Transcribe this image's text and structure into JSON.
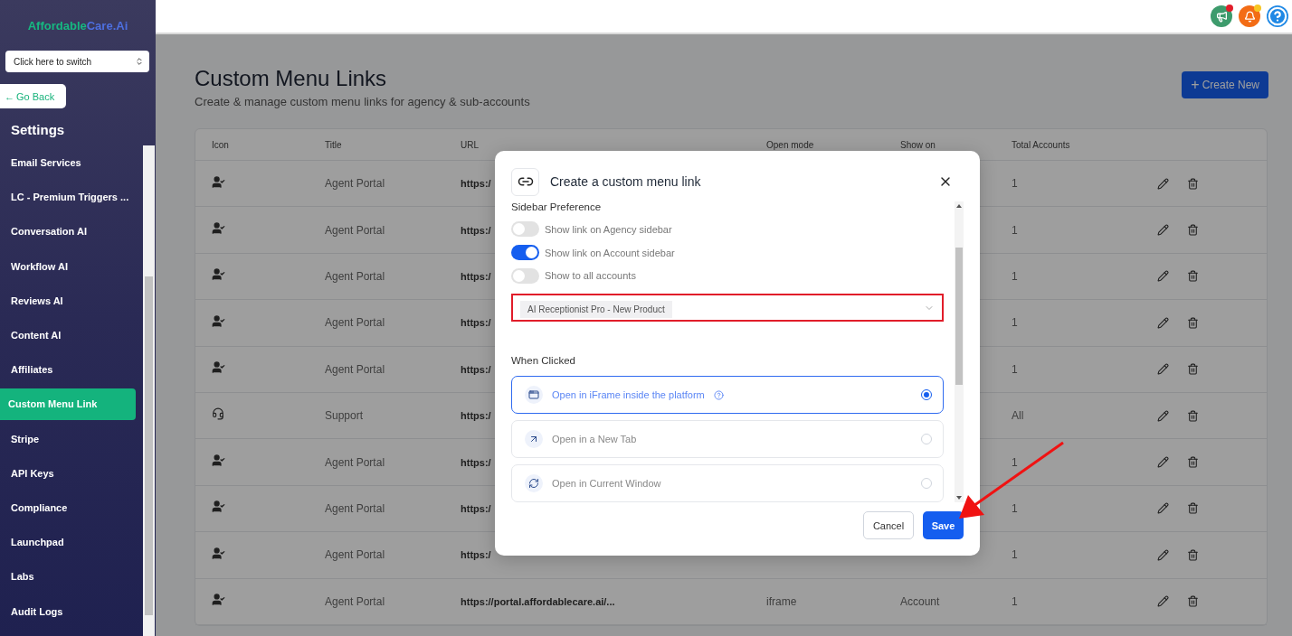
{
  "sidebar": {
    "logo": {
      "part_1": "Affordable",
      "part_2": "Care.Ai"
    },
    "switcher": {
      "value": "Click here to switch"
    },
    "back_button": {
      "icon": "←",
      "label": "Go Back"
    },
    "heading": "Settings",
    "items": [
      {
        "label": "Email Services",
        "selected": false
      },
      {
        "label": "LC - Premium Triggers ...",
        "selected": false
      },
      {
        "label": "Conversation AI",
        "selected": false
      },
      {
        "label": "Workflow AI",
        "selected": false
      },
      {
        "label": "Reviews AI",
        "selected": false
      },
      {
        "label": "Content AI",
        "selected": false
      },
      {
        "label": "Affiliates",
        "selected": false
      },
      {
        "label": "Custom Menu Link",
        "selected": true
      },
      {
        "label": "Stripe",
        "selected": false
      },
      {
        "label": "API Keys",
        "selected": false
      },
      {
        "label": "Compliance",
        "selected": false
      },
      {
        "label": "Launchpad",
        "selected": false
      },
      {
        "label": "Labs",
        "selected": false
      },
      {
        "label": "Audit Logs",
        "selected": false
      }
    ]
  },
  "topbar": {
    "buttons": [
      {
        "kind": "announcements",
        "unread": true
      },
      {
        "kind": "notifications",
        "unread": true
      },
      {
        "kind": "help",
        "unread": false
      }
    ]
  },
  "page": {
    "title": "Custom Menu Links",
    "subtitle": "Create & manage custom menu links for agency & sub-accounts",
    "create_button": {
      "icon": "+",
      "label": "Create New"
    }
  },
  "table": {
    "columns": [
      "Icon",
      "Title",
      "URL",
      "Open mode",
      "Show on",
      "Total Accounts"
    ],
    "rows": [
      {
        "kind": "agent",
        "title": "Agent Portal",
        "url": "https:/",
        "total": "1"
      },
      {
        "kind": "agent",
        "title": "Agent Portal",
        "url": "https:/",
        "total": "1"
      },
      {
        "kind": "agent",
        "title": "Agent Portal",
        "url": "https:/",
        "total": "1"
      },
      {
        "kind": "agent",
        "title": "Agent Portal",
        "url": "https:/",
        "total": "1"
      },
      {
        "kind": "agent",
        "title": "Agent Portal",
        "url": "https:/",
        "total": "1"
      },
      {
        "kind": "support",
        "title": "Support",
        "url": "https:/",
        "total": "All"
      },
      {
        "kind": "agent",
        "title": "Agent Portal",
        "url": "https:/",
        "total": "1"
      },
      {
        "kind": "agent",
        "title": "Agent Portal",
        "url": "https:/",
        "total": "1"
      },
      {
        "kind": "agent",
        "title": "Agent Portal",
        "url": "https:/",
        "total": "1"
      },
      {
        "kind": "agent",
        "title": "Agent Portal",
        "url": "https://portal.affordablecare.ai/...",
        "open_mode": "iframe",
        "show_on": "Account",
        "total": "1"
      }
    ]
  },
  "modal": {
    "title": "Create a custom menu link",
    "sidebar_preference": {
      "heading": "Sidebar Preference",
      "toggles": [
        {
          "label": "Show link on Agency sidebar",
          "on": false
        },
        {
          "label": "Show link on Account sidebar",
          "on": true
        },
        {
          "label": "Show to all accounts",
          "on": false
        }
      ],
      "accounts_field": {
        "tags": [
          "AI Receptionist Pro - New Product"
        ],
        "highlighted": true
      }
    },
    "when_clicked": {
      "heading": "When Clicked",
      "options": [
        {
          "kind": "iframe",
          "label": "Open in iFrame inside the platform",
          "help": true,
          "selected": true
        },
        {
          "kind": "new_tab",
          "label": "Open in a New Tab",
          "help": false,
          "selected": false
        },
        {
          "kind": "current_window",
          "label": "Open in Current Window",
          "help": false,
          "selected": false
        }
      ]
    },
    "buttons": {
      "cancel": "Cancel",
      "save": "Save"
    }
  }
}
